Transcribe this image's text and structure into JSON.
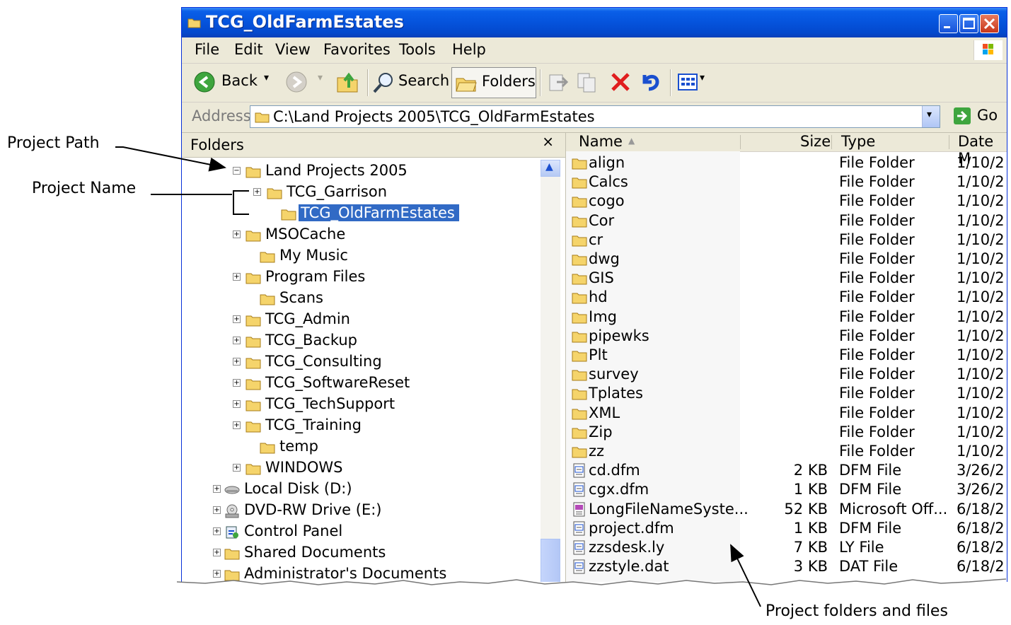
{
  "callouts": {
    "project_path": "Project Path",
    "project_name": "Project Name",
    "project_files": "Project folders and files"
  },
  "window": {
    "title": "TCG_OldFarmEstates"
  },
  "menu": [
    "File",
    "Edit",
    "View",
    "Favorites",
    "Tools",
    "Help"
  ],
  "toolbar": {
    "back": "Back",
    "search": "Search",
    "folders": "Folders"
  },
  "address": {
    "label": "Address",
    "path": "C:\\Land Projects 2005\\TCG_OldFarmEstates",
    "go": "Go"
  },
  "folders_pane": {
    "title": "Folders",
    "close": "×",
    "tree": [
      {
        "label": "Land Projects 2005",
        "expander": "⊟"
      },
      {
        "label": "TCG_Garrison",
        "expander": "⊞"
      },
      {
        "label": "TCG_OldFarmEstates",
        "expander": "",
        "selected": true
      },
      {
        "label": "MSOCache",
        "expander": "⊞"
      },
      {
        "label": "My Music",
        "expander": ""
      },
      {
        "label": "Program Files",
        "expander": "⊞"
      },
      {
        "label": "Scans",
        "expander": ""
      },
      {
        "label": "TCG_Admin",
        "expander": "⊞"
      },
      {
        "label": "TCG_Backup",
        "expander": "⊞"
      },
      {
        "label": "TCG_Consulting",
        "expander": "⊞"
      },
      {
        "label": "TCG_SoftwareReset",
        "expander": "⊞"
      },
      {
        "label": "TCG_TechSupport",
        "expander": "⊞"
      },
      {
        "label": "TCG_Training",
        "expander": "⊞"
      },
      {
        "label": "temp",
        "expander": ""
      },
      {
        "label": "WINDOWS",
        "expander": "⊞"
      },
      {
        "label": "Local Disk (D:)",
        "expander": "⊞",
        "icon": "disk-icon"
      },
      {
        "label": "DVD-RW Drive (E:)",
        "expander": "⊞",
        "icon": "dvd-icon"
      },
      {
        "label": "Control Panel",
        "expander": "⊞",
        "icon": "control-panel-icon"
      },
      {
        "label": "Shared Documents",
        "expander": "⊞",
        "icon": "folder-icon"
      },
      {
        "label": "Administrator's Documents",
        "expander": "⊞",
        "icon": "folder-icon"
      }
    ]
  },
  "files": {
    "columns": {
      "name": "Name",
      "size": "Size",
      "type": "Type",
      "date": "Date M"
    },
    "rows": [
      {
        "name": "align",
        "size": "",
        "type": "File Folder",
        "date": "1/10/2",
        "kind": "folder"
      },
      {
        "name": "Calcs",
        "size": "",
        "type": "File Folder",
        "date": "1/10/2",
        "kind": "folder"
      },
      {
        "name": "cogo",
        "size": "",
        "type": "File Folder",
        "date": "1/10/2",
        "kind": "folder"
      },
      {
        "name": "Cor",
        "size": "",
        "type": "File Folder",
        "date": "1/10/2",
        "kind": "folder"
      },
      {
        "name": "cr",
        "size": "",
        "type": "File Folder",
        "date": "1/10/2",
        "kind": "folder"
      },
      {
        "name": "dwg",
        "size": "",
        "type": "File Folder",
        "date": "1/10/2",
        "kind": "folder"
      },
      {
        "name": "GIS",
        "size": "",
        "type": "File Folder",
        "date": "1/10/2",
        "kind": "folder"
      },
      {
        "name": "hd",
        "size": "",
        "type": "File Folder",
        "date": "1/10/2",
        "kind": "folder"
      },
      {
        "name": "Img",
        "size": "",
        "type": "File Folder",
        "date": "1/10/2",
        "kind": "folder"
      },
      {
        "name": "pipewks",
        "size": "",
        "type": "File Folder",
        "date": "1/10/2",
        "kind": "folder"
      },
      {
        "name": "Plt",
        "size": "",
        "type": "File Folder",
        "date": "1/10/2",
        "kind": "folder"
      },
      {
        "name": "survey",
        "size": "",
        "type": "File Folder",
        "date": "1/10/2",
        "kind": "folder"
      },
      {
        "name": "Tplates",
        "size": "",
        "type": "File Folder",
        "date": "1/10/2",
        "kind": "folder"
      },
      {
        "name": "XML",
        "size": "",
        "type": "File Folder",
        "date": "1/10/2",
        "kind": "folder"
      },
      {
        "name": "Zip",
        "size": "",
        "type": "File Folder",
        "date": "1/10/2",
        "kind": "folder"
      },
      {
        "name": "zz",
        "size": "",
        "type": "File Folder",
        "date": "1/10/2",
        "kind": "folder"
      },
      {
        "name": "cd.dfm",
        "size": "2 KB",
        "type": "DFM File",
        "date": "3/26/2",
        "kind": "file"
      },
      {
        "name": "cgx.dfm",
        "size": "1 KB",
        "type": "DFM File",
        "date": "3/26/2",
        "kind": "file"
      },
      {
        "name": "LongFileNameSyste...",
        "size": "52 KB",
        "type": "Microsoft Off...",
        "date": "6/18/2",
        "kind": "doc"
      },
      {
        "name": "project.dfm",
        "size": "1 KB",
        "type": "DFM File",
        "date": "6/18/2",
        "kind": "file"
      },
      {
        "name": "zzsdesk.ly",
        "size": "7 KB",
        "type": "LY File",
        "date": "6/18/2",
        "kind": "file"
      },
      {
        "name": "zzstyle.dat",
        "size": "3 KB",
        "type": "DAT File",
        "date": "6/18/2",
        "kind": "file"
      }
    ]
  },
  "colors": {
    "titlebar": "#0553dc",
    "selection": "#316ac5",
    "chrome": "#ece9d8"
  }
}
